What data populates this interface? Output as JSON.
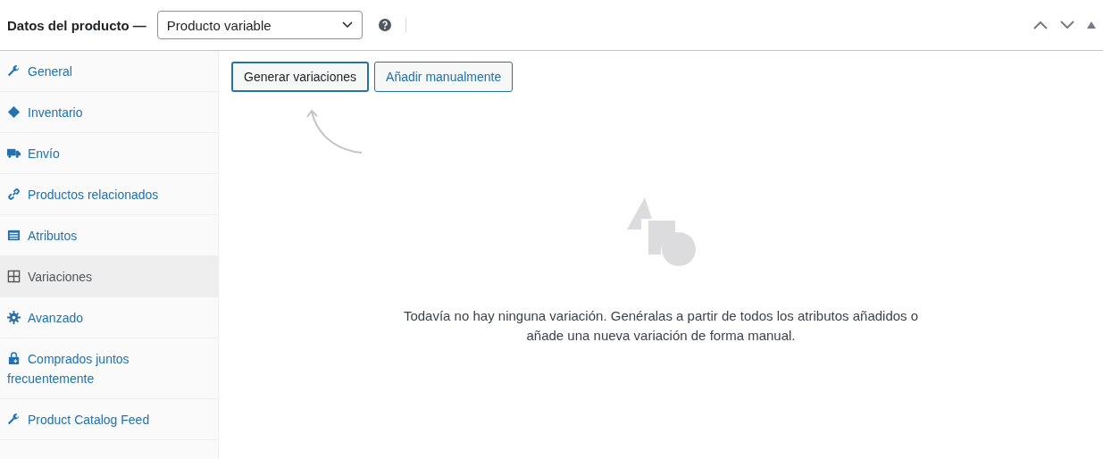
{
  "header": {
    "title": "Datos del producto —",
    "product_type": "Producto variable"
  },
  "sidebar": {
    "items": [
      {
        "label": "General",
        "kind": "wrench",
        "selected": false
      },
      {
        "label": "Inventario",
        "kind": "tag",
        "selected": false
      },
      {
        "label": "Envío",
        "kind": "truck",
        "selected": false
      },
      {
        "label": "Productos relacionados",
        "kind": "link",
        "selected": false
      },
      {
        "label": "Atributos",
        "kind": "list",
        "selected": false
      },
      {
        "label": "Variaciones",
        "kind": "grid",
        "selected": true
      },
      {
        "label": "Avanzado",
        "kind": "gear",
        "selected": false
      },
      {
        "label": "Comprados juntos frecuentemente",
        "kind": "bag",
        "selected": false
      },
      {
        "label": "Product Catalog Feed",
        "kind": "wrench",
        "selected": false
      }
    ]
  },
  "buttons": [
    {
      "label": "Generar variaciones",
      "focused": true
    },
    {
      "label": "Añadir manualmente",
      "focused": false
    }
  ],
  "empty_message": "Todavía no hay ninguna variación. Genéralas a partir de todos los atributos añadidos o añade una nueva variación de forma manual."
}
